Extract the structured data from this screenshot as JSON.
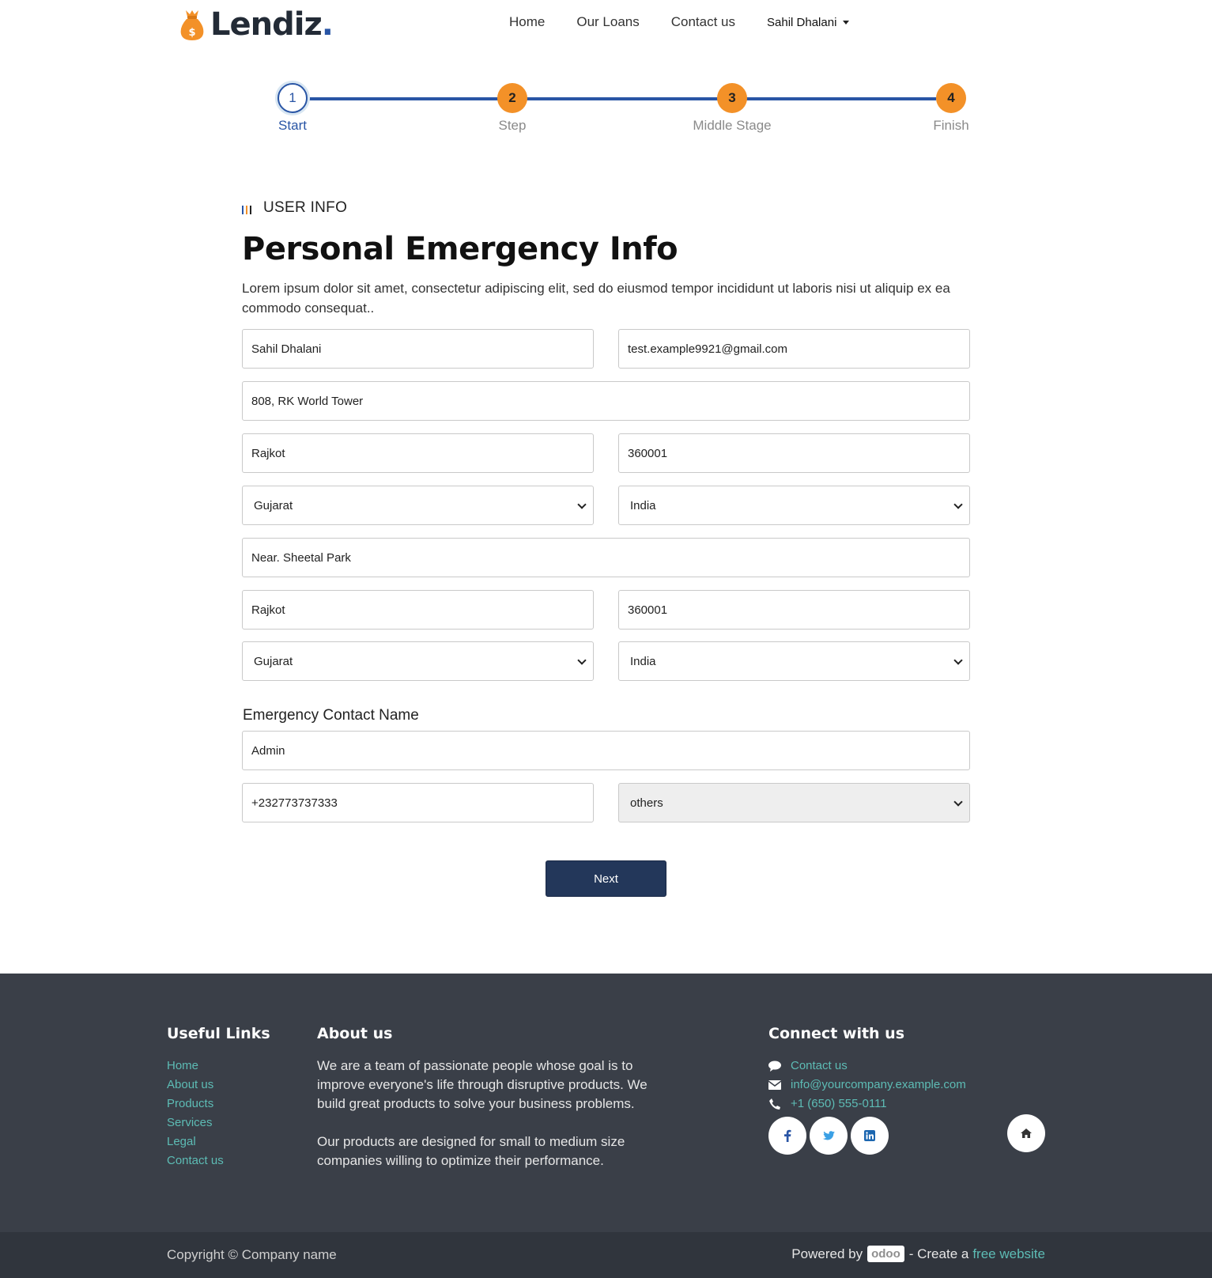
{
  "brand": {
    "name": "Lendiz",
    "dot": ".",
    "accent_color": "#f39128",
    "dot_color": "#2955a5"
  },
  "nav": {
    "links": [
      "Home",
      "Our Loans",
      "Contact us"
    ],
    "user": "Sahil Dhalani"
  },
  "stepper": {
    "steps": [
      {
        "number": "1",
        "label": "Start",
        "active": true
      },
      {
        "number": "2",
        "label": "Step",
        "active": false
      },
      {
        "number": "3",
        "label": "Middle Stage",
        "active": false
      },
      {
        "number": "4",
        "label": "Finish",
        "active": false
      }
    ],
    "line_color": "#2955a5"
  },
  "form": {
    "tag": "USER INFO",
    "title": "Personal Emergency Info",
    "description": "Lorem ipsum dolor sit amet, consectetur adipiscing elit, sed do eiusmod tempor incididunt ut laboris nisi ut aliquip ex ea commodo consequat..",
    "name": "Sahil Dhalani",
    "email": "test.example9921@gmail.com",
    "address": "808, RK World Tower",
    "city": "Rajkot",
    "zip": "360001",
    "state": "Gujarat",
    "country": "India",
    "address2": "Near. Sheetal Park",
    "city2": "Rajkot",
    "zip2": "360001",
    "state2": "Gujarat",
    "country2": "India",
    "emergency_label": "Emergency Contact Name",
    "emergency_name": "Admin",
    "emergency_phone": "+232773737333",
    "relation": "others",
    "next_label": "Next"
  },
  "footer": {
    "useful_links": {
      "title": "Useful Links",
      "items": [
        "Home",
        "About us",
        "Products",
        "Services",
        "Legal",
        "Contact us"
      ]
    },
    "about": {
      "title": "About us",
      "p1": "We are a team of passionate people whose goal is to improve everyone's life through disruptive products. We build great products to solve your business problems.",
      "p2": "Our products are designed for small to medium size companies willing to optimize their performance."
    },
    "connect": {
      "title": "Connect with us",
      "contact": "Contact us",
      "email": "info@yourcompany.example.com",
      "phone": "+1 (650) 555-0111"
    },
    "copyright": "Copyright © Company name",
    "powered_prefix": "Powered by",
    "odoo": "odoo",
    "create_text": "- Create a",
    "free_website": "free website"
  }
}
